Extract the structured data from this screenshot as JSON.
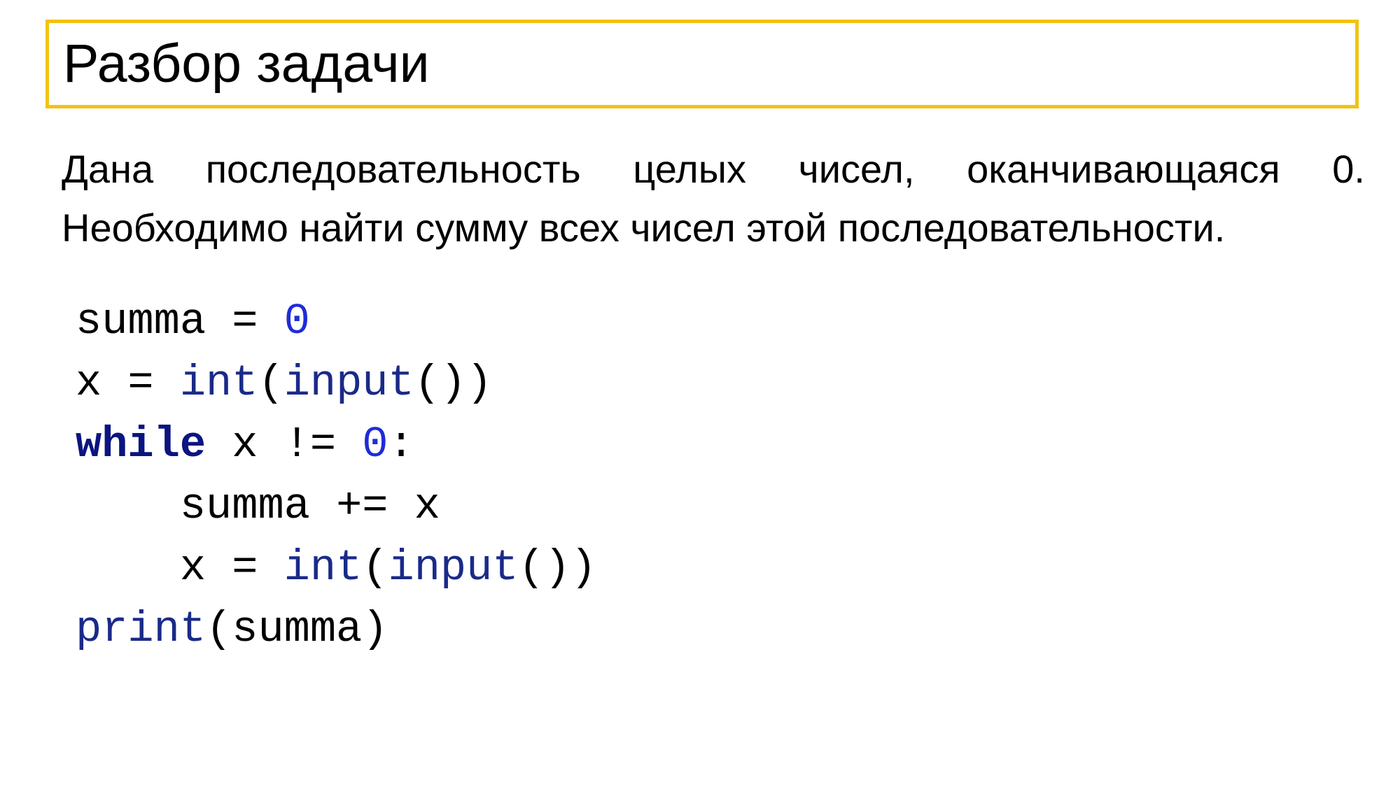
{
  "slide": {
    "title": "Разбор задачи",
    "task_line1_words": [
      "Дана",
      "последовательность",
      "целых",
      "чисел,",
      "оканчивающаяся",
      "0."
    ],
    "task_line2": "Необходимо найти сумму всех чисел этой последовательности."
  },
  "colors": {
    "title_border": "#f2c311",
    "number": "#1f2cd6",
    "builtin": "#1a2a88",
    "keyword": "#0b1480"
  },
  "code": {
    "l1": {
      "a": "summa",
      "b": " = ",
      "c": "0"
    },
    "l2": {
      "a": "x",
      "b": " = ",
      "c": "int",
      "d": "(",
      "e": "input",
      "f": "())"
    },
    "l3": {
      "a": "while",
      "b": " x != ",
      "c": "0",
      "d": ":"
    },
    "l4": {
      "indent": "    ",
      "a": "summa += x"
    },
    "l5": {
      "indent": "    ",
      "a": "x",
      "b": " = ",
      "c": "int",
      "d": "(",
      "e": "input",
      "f": "())"
    },
    "l6": {
      "a": "print",
      "b": "(summa)"
    }
  }
}
